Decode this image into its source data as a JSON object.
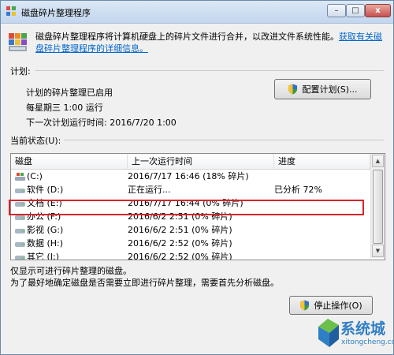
{
  "window": {
    "title": "磁盘碎片整理程序",
    "buttons": {
      "minimize": "–",
      "maximize": "□",
      "close": "x"
    }
  },
  "intro": {
    "text": "磁盘碎片整理程序将计算机硬盘上的碎片文件进行合并，以改进文件系统性能。",
    "link": "获取有关磁盘碎片整理程序的详细信息。"
  },
  "schedule": {
    "section_label": "计划:",
    "status": "计划的碎片整理已启用",
    "frequency": "每星期三  1:00 运行",
    "next_run": "下一次计划运行时间: 2016/7/20 1:00",
    "configure_button": "配置计划(S)..."
  },
  "current_status": {
    "section_label": "当前状态(U):",
    "columns": [
      "磁盘",
      "上一次运行时间",
      "进度"
    ],
    "rows": [
      {
        "disk": "(C:)",
        "last_run": "2016/7/17 16:46 (18% 碎片)",
        "progress": "",
        "icon": "windows-drive-icon"
      },
      {
        "disk": "软件 (D:)",
        "last_run": "正在运行...",
        "progress": "已分析 72%",
        "icon": "drive-icon"
      },
      {
        "disk": "文档 (E:)",
        "last_run": "2016/7/17 16:44 (0% 碎片)",
        "progress": "",
        "icon": "drive-icon"
      },
      {
        "disk": "办公 (F:)",
        "last_run": "2016/6/2 2:51 (0% 碎片)",
        "progress": "",
        "icon": "drive-icon"
      },
      {
        "disk": "影视 (G:)",
        "last_run": "2016/6/2 2:51 (0% 碎片)",
        "progress": "",
        "icon": "drive-icon"
      },
      {
        "disk": "数据 (H:)",
        "last_run": "2016/6/2 2:52 (0% 碎片)",
        "progress": "",
        "icon": "drive-icon"
      },
      {
        "disk": "其它 (I:)",
        "last_run": "2016/6/2 2:52 (0% 碎片)",
        "progress": "",
        "icon": "drive-icon"
      }
    ]
  },
  "notes": {
    "line1": "仅显示可进行碎片整理的磁盘。",
    "line2": "为了最好地确定磁盘是否需要立即进行碎片整理，需要首先分析磁盘。"
  },
  "stop_button": "停止操作(O)",
  "watermark": {
    "text": "系统城",
    "url": "xitongcheng.com"
  },
  "colors": {
    "highlight": "#d8232a",
    "link": "#0066cc",
    "watermark": "#2f7fc4"
  }
}
